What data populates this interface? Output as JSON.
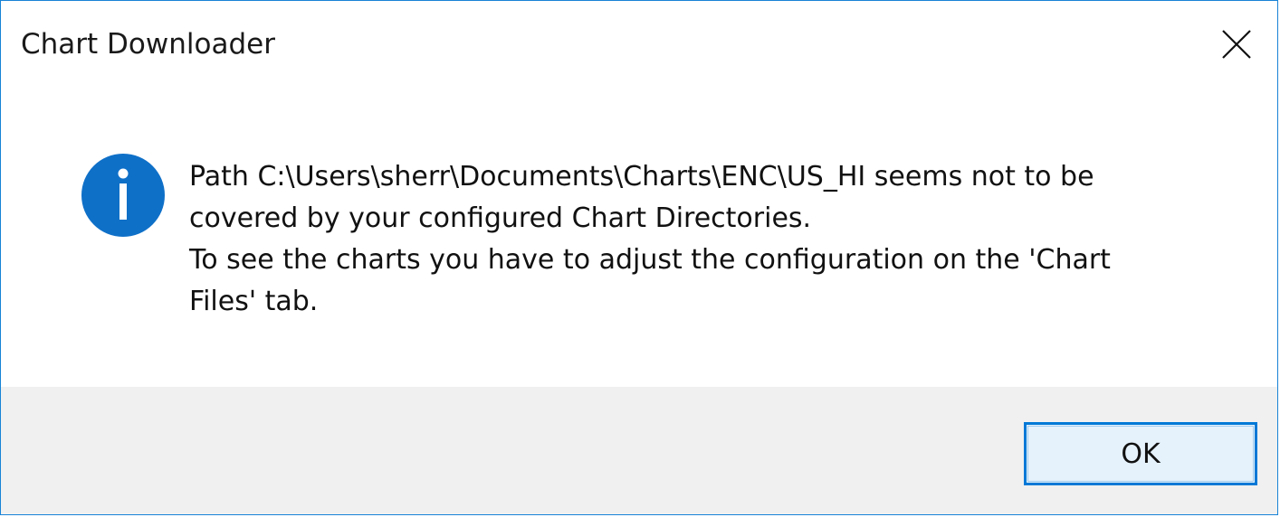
{
  "window": {
    "title": "Chart Downloader",
    "close_icon": "close-icon",
    "border_color": "#1883d7"
  },
  "message": {
    "icon": "info-icon",
    "icon_color": "#0f70c8",
    "lines": [
      "Path C:\\Users\\sherr\\Documents\\Charts\\ENC\\US_HI seems not to be",
      "covered by your configured Chart Directories.",
      "To see the charts you have to adjust the configuration on the 'Chart",
      "Files' tab."
    ]
  },
  "buttons": {
    "ok_label": "OK",
    "ok_accent": "#0078d7"
  }
}
